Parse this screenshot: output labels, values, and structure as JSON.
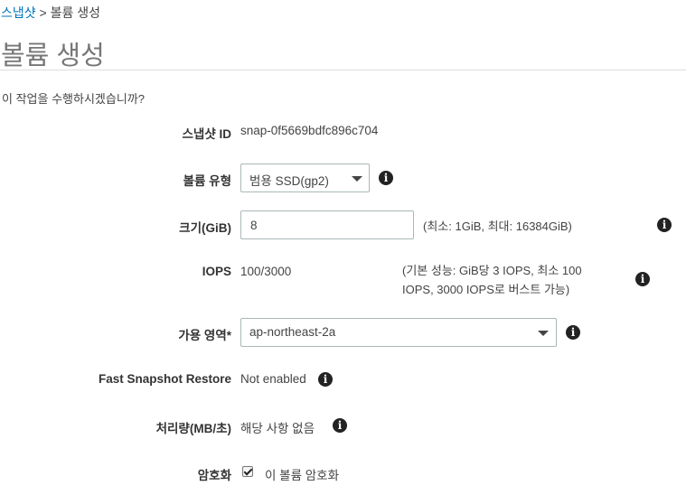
{
  "breadcrumb": {
    "parent": "스냅샷",
    "separator": ">",
    "current": "볼륨 생성"
  },
  "page_title": "볼륨 생성",
  "question": "이 작업을 수행하시겠습니까?",
  "icons": {
    "info": "info-icon",
    "caret": "caret-down-icon",
    "check": "checkmark-icon"
  },
  "form": {
    "snapshot_id": {
      "label": "스냅샷 ID",
      "value": "snap-0f5669bdfc896c704"
    },
    "volume_type": {
      "label": "볼륨 유형",
      "selected": "범용 SSD(gp2)"
    },
    "size": {
      "label": "크기(GiB)",
      "value": "8",
      "hint": "(최소: 1GiB, 최대: 16384GiB)"
    },
    "iops": {
      "label": "IOPS",
      "value": "100/3000",
      "hint_line1": "(기본 성능: GiB당 3 IOPS, 최소 100",
      "hint_line2": "IOPS, 3000 IOPS로 버스트 가능)"
    },
    "availability_zone": {
      "label": "가용 영역*",
      "selected": "ap-northeast-2a"
    },
    "fast_snapshot_restore": {
      "label": "Fast Snapshot Restore",
      "value": "Not enabled"
    },
    "throughput": {
      "label": "처리량(MB/초)",
      "value": "해당 사항 없음"
    },
    "encryption": {
      "label": "암호화",
      "checkbox_label": "이 볼륨 암호화",
      "checked": true
    }
  }
}
